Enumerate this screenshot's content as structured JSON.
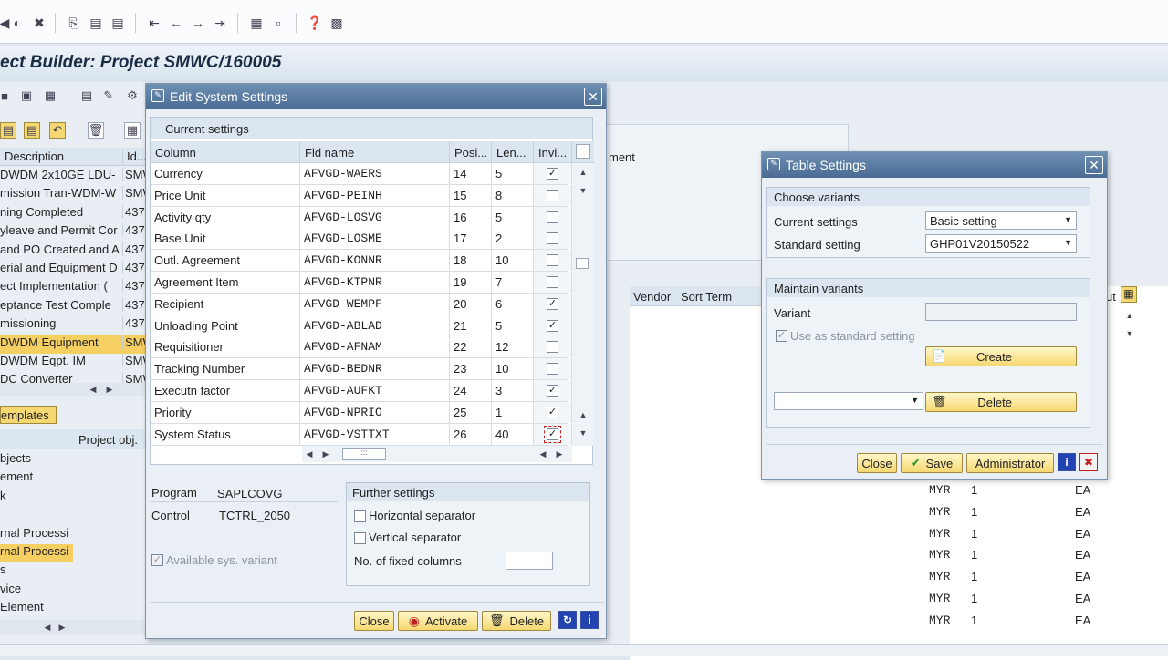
{
  "app": {
    "title": "ect Builder: Project SMWC/160005"
  },
  "bg_left": {
    "header_description": "Description",
    "header_id": "Id...",
    "rows": [
      {
        "d": "DWDM 2x10GE LDU-",
        "i": "SMW"
      },
      {
        "d": "mission Tran-WDM-W",
        "i": "SMW"
      },
      {
        "d": "ning Completed",
        "i": "437"
      },
      {
        "d": "yleave and Permit Cor",
        "i": "437"
      },
      {
        "d": "and PO Created and A",
        "i": "437"
      },
      {
        "d": "erial and Equipment D",
        "i": "437"
      },
      {
        "d": "ect Implementation (",
        "i": "437"
      },
      {
        "d": "eptance Test Comple",
        "i": "437"
      },
      {
        "d": "missioning",
        "i": "437"
      },
      {
        "d": "DWDM Equipment",
        "i": "SMW"
      },
      {
        "d": "DWDM Eqpt. IM",
        "i": "SMW"
      },
      {
        "d": "DC Converter",
        "i": "SMW"
      }
    ],
    "templates_label": "emplates",
    "project_obj_header": "Project obj.",
    "tree": [
      "bjects",
      "ement",
      "k",
      "",
      "rnal Processi",
      "rnal Processi",
      "s",
      "vice",
      "Element"
    ]
  },
  "bg_right": {
    "field_label": "ment",
    "col_vendor": "Vendor",
    "col_sort_term": "Sort Term",
    "col_ut": "ut",
    "rows": [
      {
        "cur": "MYR",
        "qty": "1",
        "unit": "EA"
      },
      {
        "cur": "MYR",
        "qty": "1",
        "unit": "EA"
      },
      {
        "cur": "MYR",
        "qty": "1",
        "unit": "EA"
      },
      {
        "cur": "MYR",
        "qty": "1",
        "unit": "EA"
      },
      {
        "cur": "MYR",
        "qty": "1",
        "unit": "EA"
      },
      {
        "cur": "MYR",
        "qty": "1",
        "unit": "EA"
      },
      {
        "cur": "MYR",
        "qty": "1",
        "unit": "EA"
      }
    ]
  },
  "edit_dialog": {
    "title": "Edit System Settings",
    "current_settings": "Current settings",
    "columns": [
      "Column",
      "Fld name",
      "Posi...",
      "Len...",
      "Invi..."
    ],
    "rows": [
      {
        "col": "Currency",
        "fld": "AFVGD-WAERS",
        "pos": "14",
        "len": "5",
        "inv": true
      },
      {
        "col": "Price Unit",
        "fld": "AFVGD-PEINH",
        "pos": "15",
        "len": "8",
        "inv": false
      },
      {
        "col": "Activity qty",
        "fld": "AFVGD-LOSVG",
        "pos": "16",
        "len": "5",
        "inv": false
      },
      {
        "col": "Base Unit",
        "fld": "AFVGD-LOSME",
        "pos": "17",
        "len": "2",
        "inv": false
      },
      {
        "col": "Outl. Agreement",
        "fld": "AFVGD-KONNR",
        "pos": "18",
        "len": "10",
        "inv": false
      },
      {
        "col": "Agreement Item",
        "fld": "AFVGD-KTPNR",
        "pos": "19",
        "len": "7",
        "inv": false
      },
      {
        "col": "Recipient",
        "fld": "AFVGD-WEMPF",
        "pos": "20",
        "len": "6",
        "inv": true
      },
      {
        "col": "Unloading Point",
        "fld": "AFVGD-ABLAD",
        "pos": "21",
        "len": "5",
        "inv": true
      },
      {
        "col": "Requisitioner",
        "fld": "AFVGD-AFNAM",
        "pos": "22",
        "len": "12",
        "inv": false
      },
      {
        "col": "Tracking Number",
        "fld": "AFVGD-BEDNR",
        "pos": "23",
        "len": "10",
        "inv": false
      },
      {
        "col": "Executn factor",
        "fld": "AFVGD-AUFKT",
        "pos": "24",
        "len": "3",
        "inv": true
      },
      {
        "col": "Priority",
        "fld": "AFVGD-NPRIO",
        "pos": "25",
        "len": "1",
        "inv": true
      },
      {
        "col": "System Status",
        "fld": "AFVGD-VSTTXT",
        "pos": "26",
        "len": "40",
        "inv": true
      }
    ],
    "program_label": "Program",
    "program_value": "SAPLCOVG",
    "control_label": "Control",
    "control_value": "TCTRL_2050",
    "available_label": "Available sys. variant",
    "further_settings": "Further settings",
    "horizontal_sep": "Horizontal separator",
    "vertical_sep": "Vertical separator",
    "fixed_cols_label": "No. of fixed columns",
    "fixed_cols_value": "",
    "btn_close": "Close",
    "btn_activate": "Activate",
    "btn_delete": "Delete"
  },
  "table_dialog": {
    "title": "Table Settings",
    "choose_variants": "Choose variants",
    "current_settings_label": "Current settings",
    "current_settings_value": "Basic setting",
    "standard_setting_label": "Standard setting",
    "standard_setting_value": "GHP01V20150522",
    "maintain_variants": "Maintain variants",
    "variant_label": "Variant",
    "variant_value": "",
    "use_as_standard": "Use as standard setting",
    "btn_create": "Create",
    "btn_delete": "Delete",
    "btn_close": "Close",
    "btn_save": "Save",
    "btn_admin": "Administrator"
  },
  "colors": {
    "accent": "#4a6c94",
    "selected": "#f6cf62",
    "button": "#f6d872"
  }
}
